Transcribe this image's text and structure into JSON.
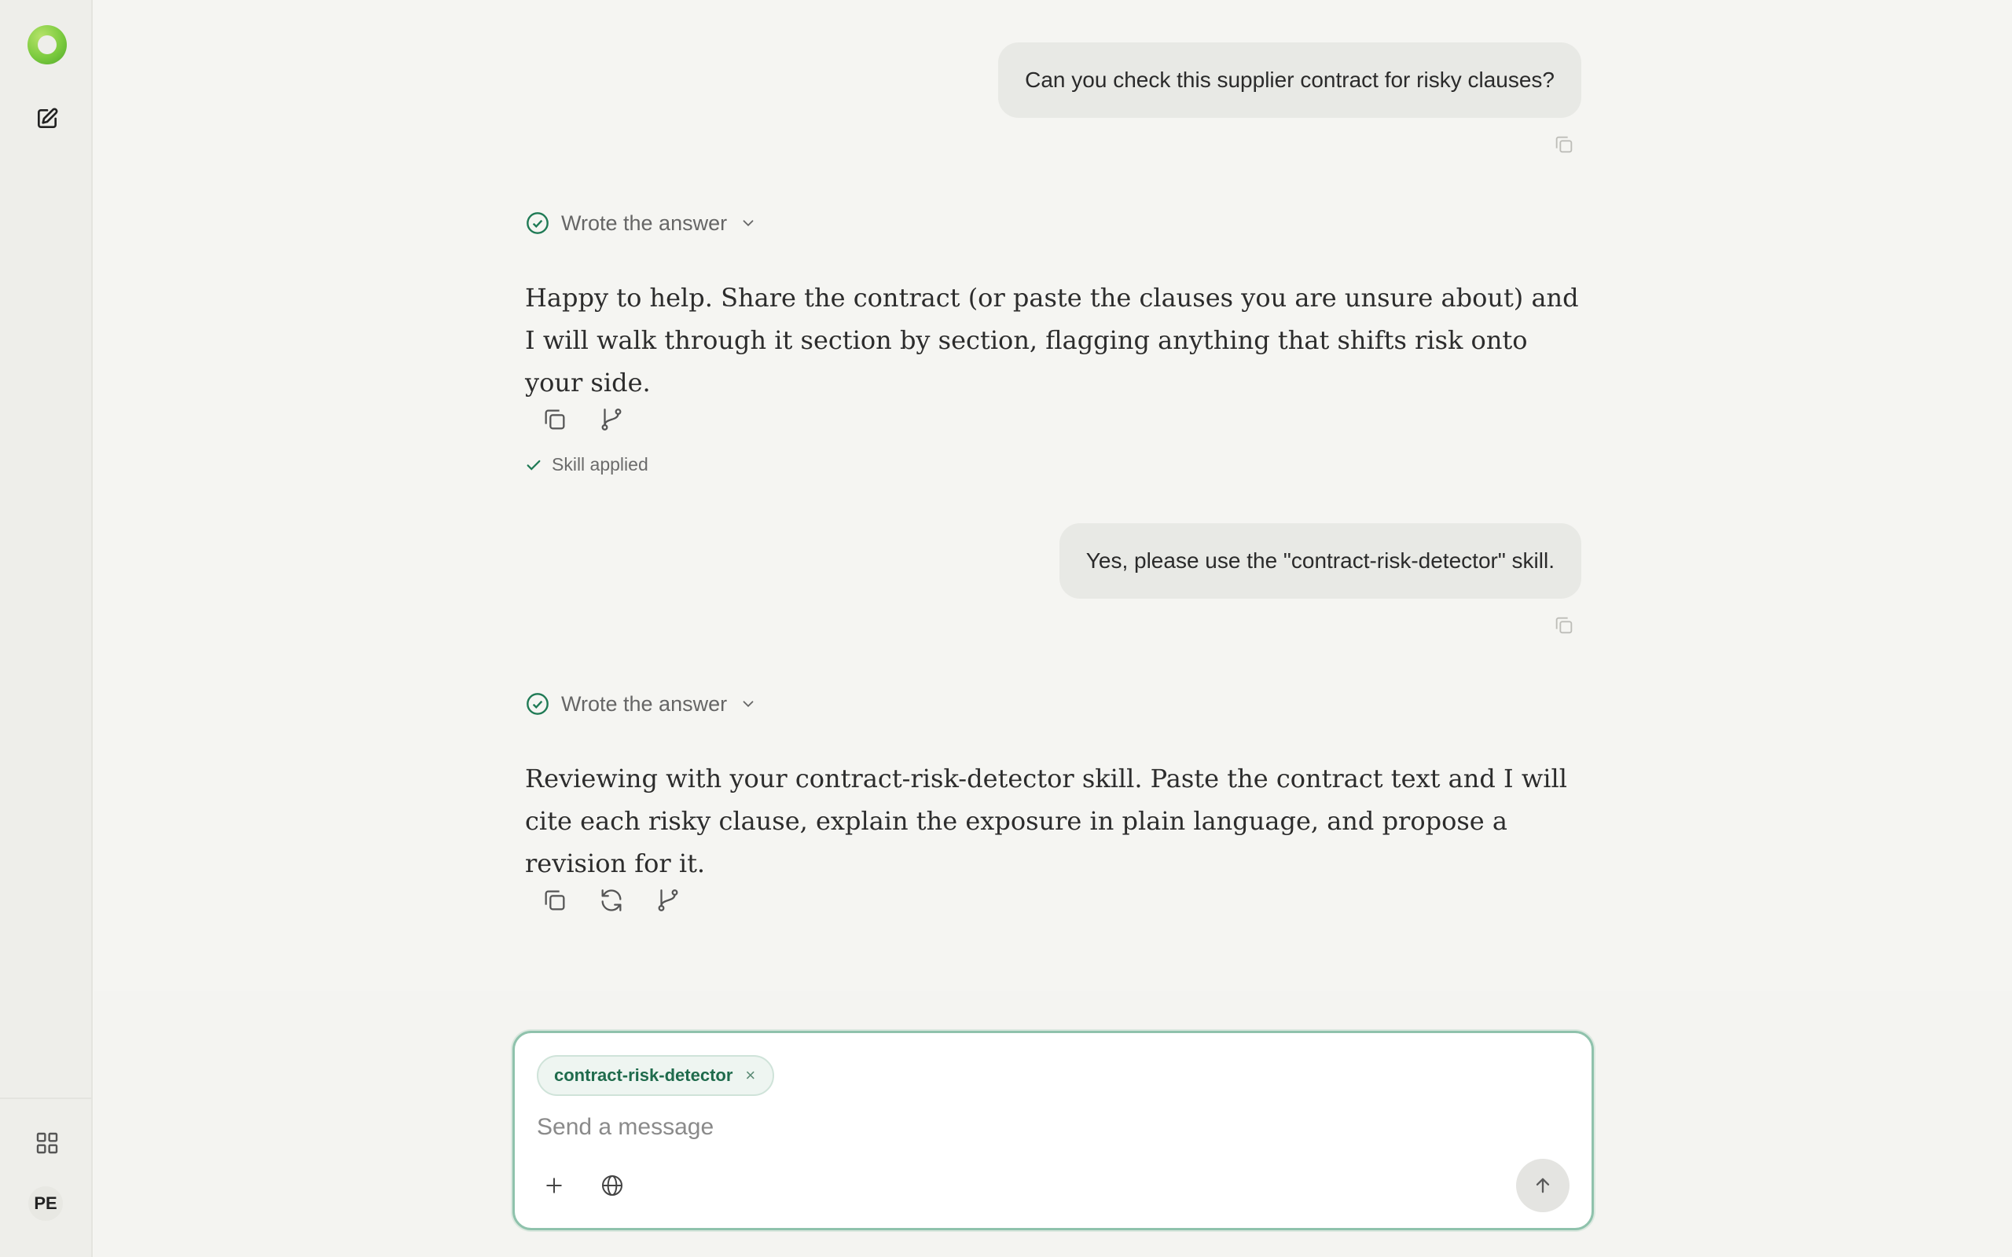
{
  "sidebar": {
    "avatar_initials": "PE"
  },
  "conversation": {
    "user_message_1": "Can you check this supplier contract for risky clauses?",
    "assistant_1": {
      "status": "Wrote the answer",
      "text": "Happy to help. Share the contract (or paste the clauses you are unsure about) and I will walk through it section by section, flagging anything that shifts risk onto your side.",
      "skill_status": "Skill applied"
    },
    "user_message_2": "Yes, please use the \"contract-risk-detector\" skill.",
    "assistant_2": {
      "status": "Wrote the answer",
      "text": "Reviewing with your contract-risk-detector skill. Paste the contract text and I will cite each risky clause, explain the exposure in plain language, and propose a revision for it."
    }
  },
  "composer": {
    "skill_chip": "contract-risk-detector",
    "chip_remove": "×",
    "placeholder": "Send a message"
  },
  "colors": {
    "accent_green": "#1f7a55",
    "logo_green": "#7ccb3f",
    "background": "#f5f5f2",
    "user_bubble": "#e8e9e5"
  }
}
